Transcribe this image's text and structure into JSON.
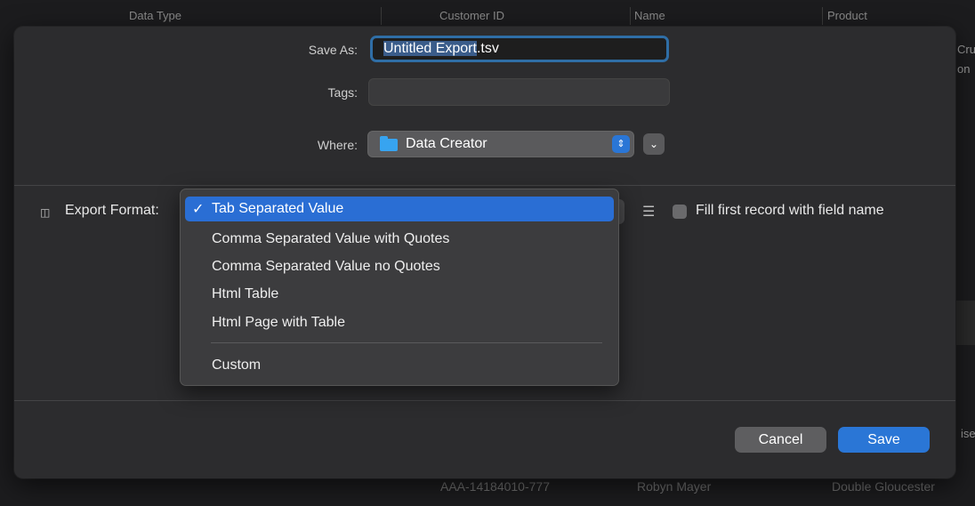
{
  "background": {
    "headers": [
      "Data Type",
      "Customer ID",
      "Name",
      "Product"
    ],
    "right_fragments": [
      "Cru",
      "on"
    ],
    "bottom_row": [
      "AAA-14184010-777",
      "Robyn Mayer",
      "Double Gloucester"
    ],
    "right_edge_fragment": "ise"
  },
  "dialog": {
    "save_as_label": "Save As:",
    "filename_selected": "Untitled Export",
    "filename_ext": ".tsv",
    "tags_label": "Tags:",
    "tags_value": "",
    "where_label": "Where:",
    "where_value": "Data Creator",
    "export_format_label": "Export Format:",
    "fill_first_record_label": "Fill first record with field name",
    "cancel_label": "Cancel",
    "save_label": "Save"
  },
  "format_menu": {
    "selected_index": 0,
    "items": [
      "Tab Separated Value",
      "Comma Separated Value with Quotes",
      "Comma Separated Value no Quotes",
      "Html Table",
      "Html Page with Table"
    ],
    "custom_item": "Custom"
  },
  "icons": {
    "folder": "folder-icon",
    "stepper": "stepper-icon",
    "expand": "chevron-down-icon",
    "columns": "columns-icon",
    "list": "list-icon",
    "check": "checkmark-icon"
  },
  "colors": {
    "accent": "#2a76d6",
    "folder": "#37a4f0"
  }
}
